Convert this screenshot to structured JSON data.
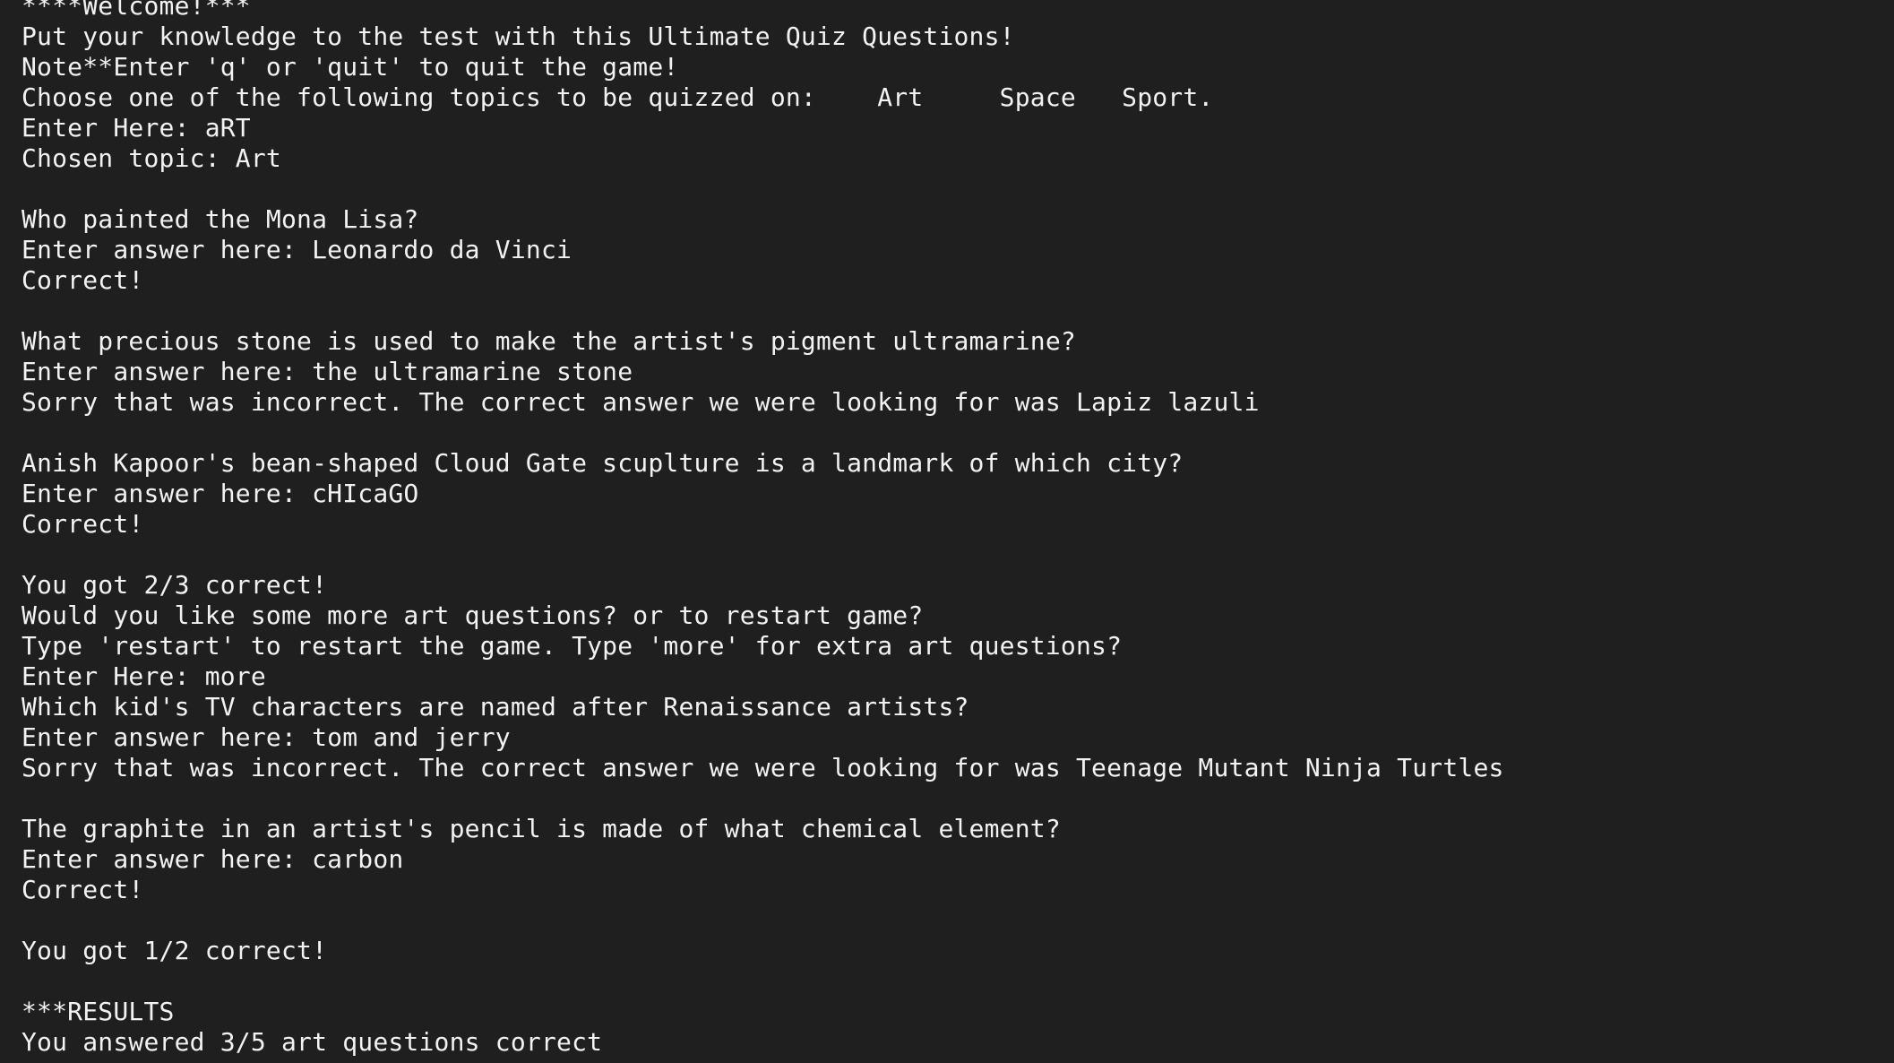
{
  "terminal": {
    "lines": [
      "****Welcome!***",
      "Put your knowledge to the test with this Ultimate Quiz Questions!",
      "Note**Enter 'q' or 'quit' to quit the game!",
      "Choose one of the following topics to be quizzed on:    Art     Space   Sport.",
      "Enter Here: aRT",
      "Chosen topic: Art",
      "",
      "Who painted the Mona Lisa?",
      "Enter answer here: Leonardo da Vinci",
      "Correct!",
      "",
      "What precious stone is used to make the artist's pigment ultramarine?",
      "Enter answer here: the ultramarine stone",
      "Sorry that was incorrect. The correct answer we were looking for was Lapiz lazuli",
      "",
      "Anish Kapoor's bean-shaped Cloud Gate scuplture is a landmark of which city?",
      "Enter answer here: cHIcaGO",
      "Correct!",
      "",
      "You got 2/3 correct!",
      "Would you like some more art questions? or to restart game?",
      "Type 'restart' to restart the game. Type 'more' for extra art questions?",
      "Enter Here: more",
      "Which kid's TV characters are named after Renaissance artists?",
      "Enter answer here: tom and jerry",
      "Sorry that was incorrect. The correct answer we were looking for was Teenage Mutant Ninja Turtles",
      "",
      "The graphite in an artist's pencil is made of what chemical element?",
      "Enter answer here: carbon",
      "Correct!",
      "",
      "You got 1/2 correct!",
      "",
      "***RESULTS",
      "You answered 3/5 art questions correct"
    ]
  }
}
